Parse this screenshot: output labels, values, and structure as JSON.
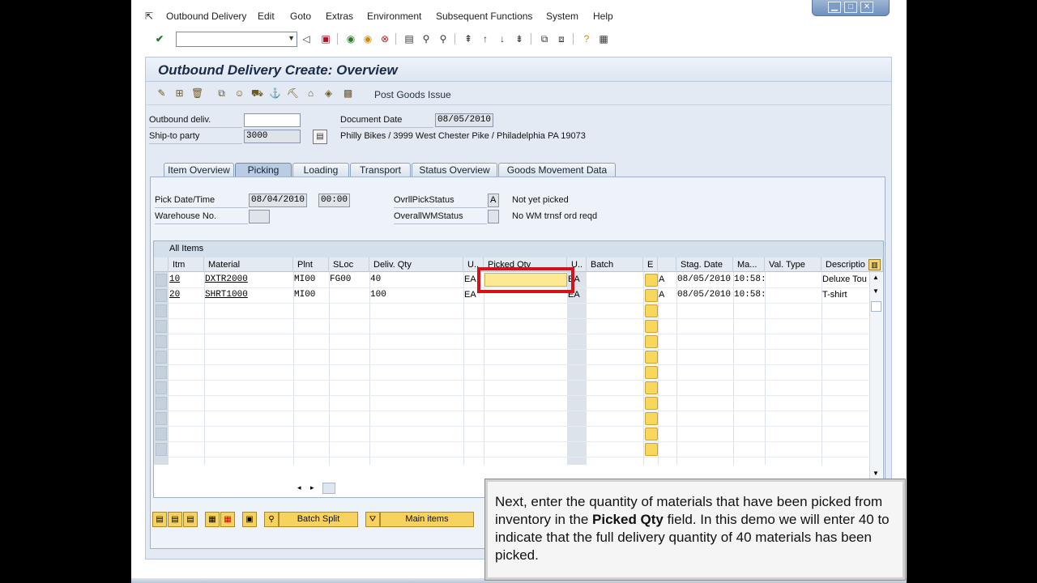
{
  "menu": {
    "items": [
      "Outbound Delivery",
      "Edit",
      "Goto",
      "Extras",
      "Environment",
      "Subsequent Functions",
      "System",
      "Help"
    ]
  },
  "title": "Outbound Delivery  Create: Overview",
  "app_toolbar": {
    "post_goods_issue": "Post Goods Issue"
  },
  "header": {
    "outbound_deliv_label": "Outbound deliv.",
    "outbound_deliv_value": "",
    "ship_to_label": "Ship-to party",
    "ship_to_value": "3000",
    "doc_date_label": "Document Date",
    "doc_date_value": "08/05/2010",
    "ship_to_address": "Philly Bikes / 3999 West Chester Pike / Philadelphia PA 19073"
  },
  "tabs": [
    "Item Overview",
    "Picking",
    "Loading",
    "Transport",
    "Status Overview",
    "Goods Movement Data"
  ],
  "active_tab": "Picking",
  "picking": {
    "pick_date_label": "Pick Date/Time",
    "pick_date": "08/04/2010",
    "pick_time": "00:00",
    "warehouse_label": "Warehouse No.",
    "warehouse_value": "",
    "ovrl_pick_label": "OvrllPickStatus",
    "ovrl_pick_value": "A",
    "ovrl_pick_text": "Not yet picked",
    "overall_wm_label": "OverallWMStatus",
    "overall_wm_value": "",
    "overall_wm_text": "No WM trnsf ord reqd"
  },
  "grid": {
    "title": "All Items",
    "columns": [
      "Itm",
      "Material",
      "Plnt",
      "SLoc",
      "Deliv. Qty",
      "U..",
      "Picked Qty",
      "U..",
      "Batch",
      "E",
      "",
      "Stag. Date",
      "Ma...",
      "Val. Type",
      "Descriptio"
    ],
    "rows": [
      {
        "itm": "10",
        "material": "DXTR2000",
        "plnt": "MI00",
        "sloc": "FG00",
        "qty": "40",
        "u1": "EA",
        "picked": "",
        "u2": "EA",
        "batch": "",
        "e": "",
        "a": "A",
        "stag": "08/05/2010",
        "time": "10:58:",
        "valtype": "",
        "desc": "Deluxe Tou"
      },
      {
        "itm": "20",
        "material": "SHRT1000",
        "plnt": "MI00",
        "sloc": "",
        "qty": "100",
        "u1": "EA",
        "picked": "",
        "u2": "EA",
        "batch": "",
        "e": "",
        "a": "A",
        "stag": "08/05/2010",
        "time": "10:58:",
        "valtype": "",
        "desc": "T-shirt"
      }
    ]
  },
  "buttons": {
    "batch_split": "Batch Split",
    "main_items": "Main items"
  },
  "callout": {
    "part1": "Next, enter the quantity of materials that have been picked from inventory in the ",
    "bold": "Picked Qty",
    "part2": " field. In this demo we will enter 40 to indicate that the full delivery quantity of 40 materials has been picked."
  },
  "colors": {
    "highlight": "#d8101a",
    "yellow_button": "#f8d25e",
    "screen_bg": "#e3eaf3"
  }
}
